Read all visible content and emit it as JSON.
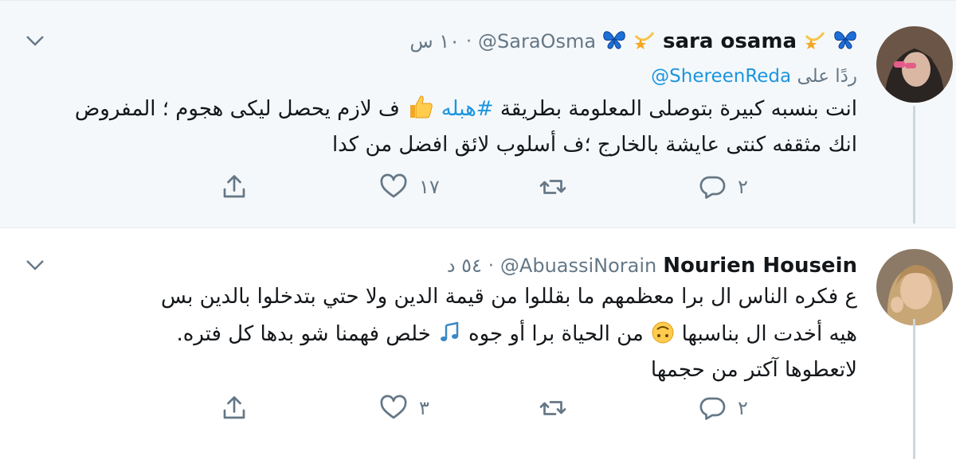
{
  "tweets": [
    {
      "name": "sara osama",
      "handle": "@SaraOsma",
      "time": "١٠ س",
      "replying_label": "ردًا على",
      "replying_handle": "@ShereenReda",
      "text_part1": "انت بنسبه كبيرة بتوصلى المعلومة بطريقة ",
      "hashtag": "#هبله",
      "text_part2": " ف لازم يحصل ليكى هجوم ؛ المفروض انك مثقفه كنتى عايشة بالخارج ؛ف أسلوب لائق افضل من كدا",
      "replies": "٢",
      "retweets": "",
      "likes": "١٧"
    },
    {
      "name": "Nourien Housein",
      "handle": "@AbuassiNorain",
      "time": "٥٤ د",
      "text_line1": "ع فكره الناس ال برا معظمهم ما بقللوا من قيمة الدين ولا حتي بتدخلوا بالدين بس",
      "text_line2a": "هيه أخدت ال بناسبها",
      "text_line2b": " من الحياة برا أو جوه ",
      "text_line2c": "خلص فهمنا شو بدها كل فتره.",
      "text_line3": "لاتعطوها آكتر من حجمها",
      "replies": "٢",
      "retweets": "",
      "likes": "٣"
    }
  ],
  "colors": {
    "link": "#1b95e0",
    "muted": "#657786",
    "text": "#14171a",
    "thread_line": "#ccd6dd",
    "highlight_bg": "#f5f8fa"
  },
  "icons": {
    "more": "chevron-down-icon",
    "reply": "reply-icon",
    "retweet": "retweet-icon",
    "like": "heart-icon",
    "share": "share-icon"
  }
}
